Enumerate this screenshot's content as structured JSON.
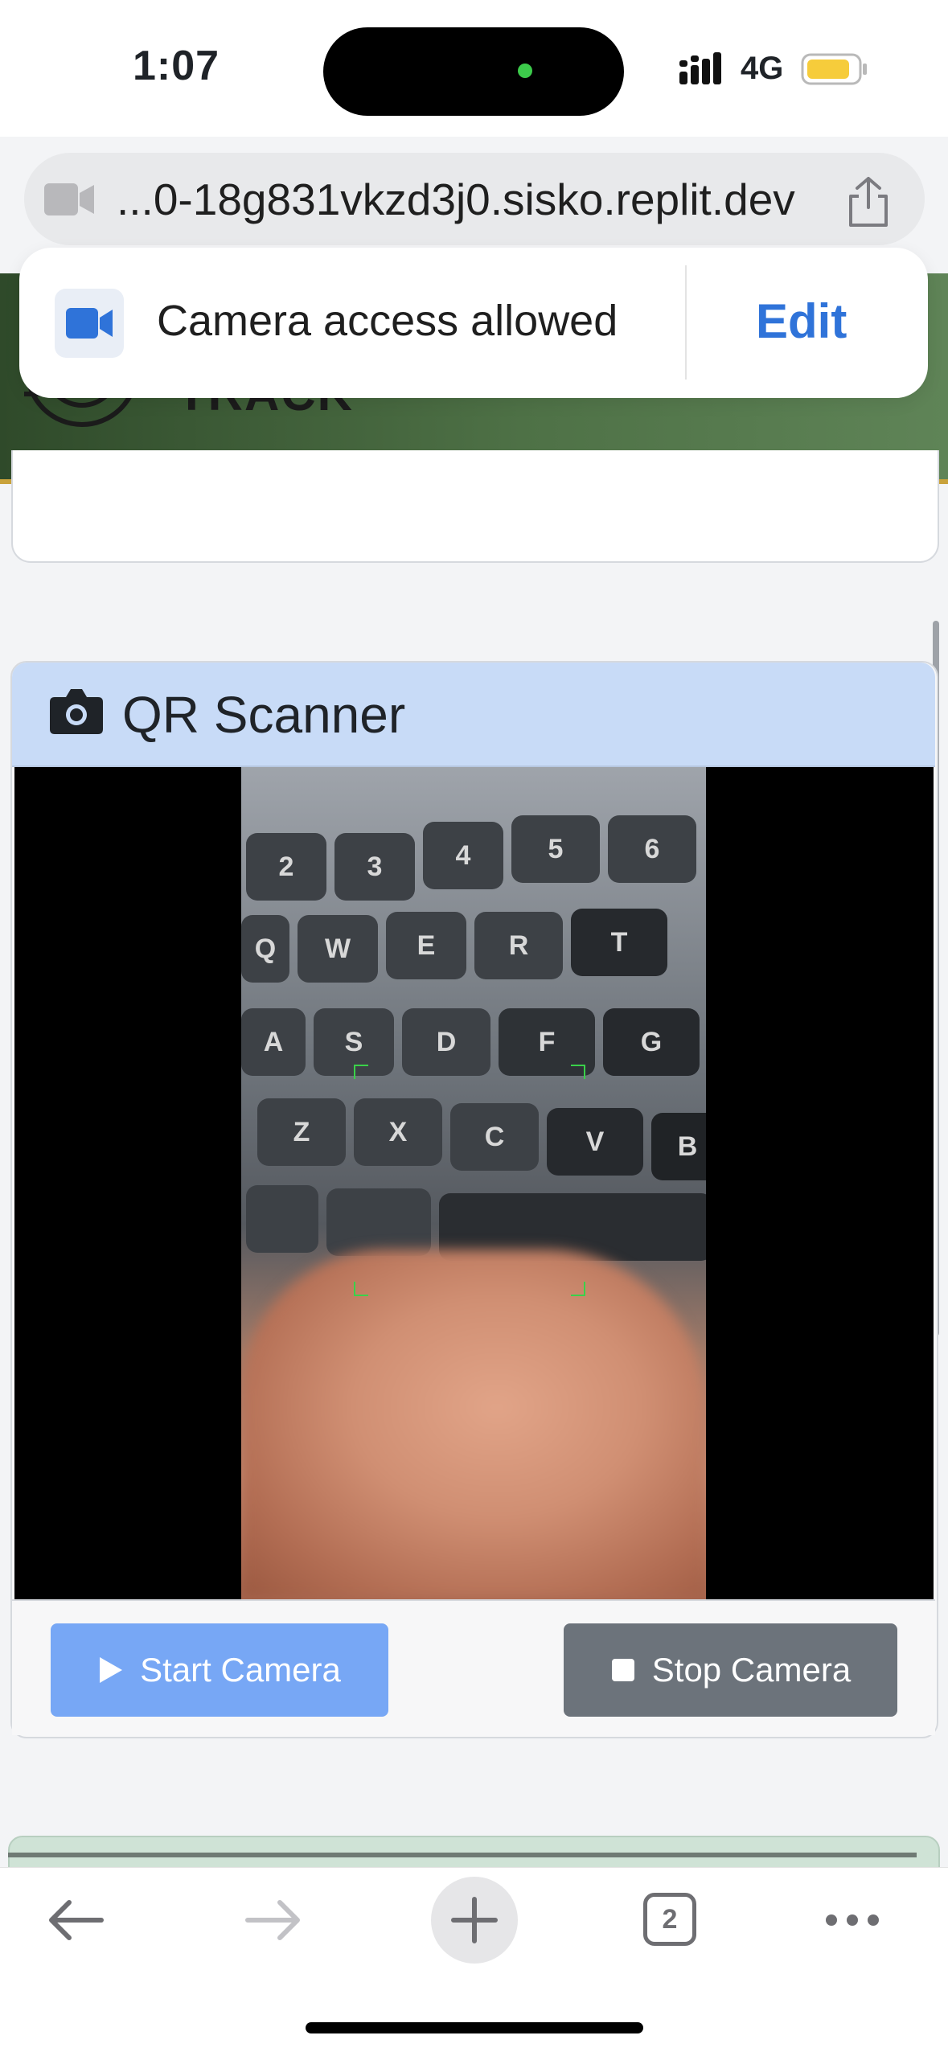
{
  "status_bar": {
    "time": "1:07",
    "network": "4G",
    "battery_color": "#f6cc3b"
  },
  "address_bar": {
    "url": "...0-18g831vkzd3j0.sisko.replit.dev",
    "left_icon": "video-camera-icon",
    "right_icon": "share-icon"
  },
  "permission_popup": {
    "message": "Camera access allowed",
    "action_label": "Edit",
    "icon": "video-camera-icon"
  },
  "app_header": {
    "title": "TRACK",
    "logo_icon": "target-logo-icon",
    "accent": "#c9a23b"
  },
  "qr_card": {
    "title": "QR Scanner",
    "header_icon": "camera-icon",
    "header_color": "#c8dbf7",
    "start_label": "Start Camera",
    "stop_label": "Stop Camera",
    "start_color": "#77a7f5",
    "stop_color": "#6c737b"
  },
  "toolbar": {
    "back_icon": "arrow-left-icon",
    "forward_icon": "arrow-right-icon",
    "new_tab_icon": "plus-icon",
    "tabs_count": "2",
    "more_icon": "ellipsis-icon"
  }
}
